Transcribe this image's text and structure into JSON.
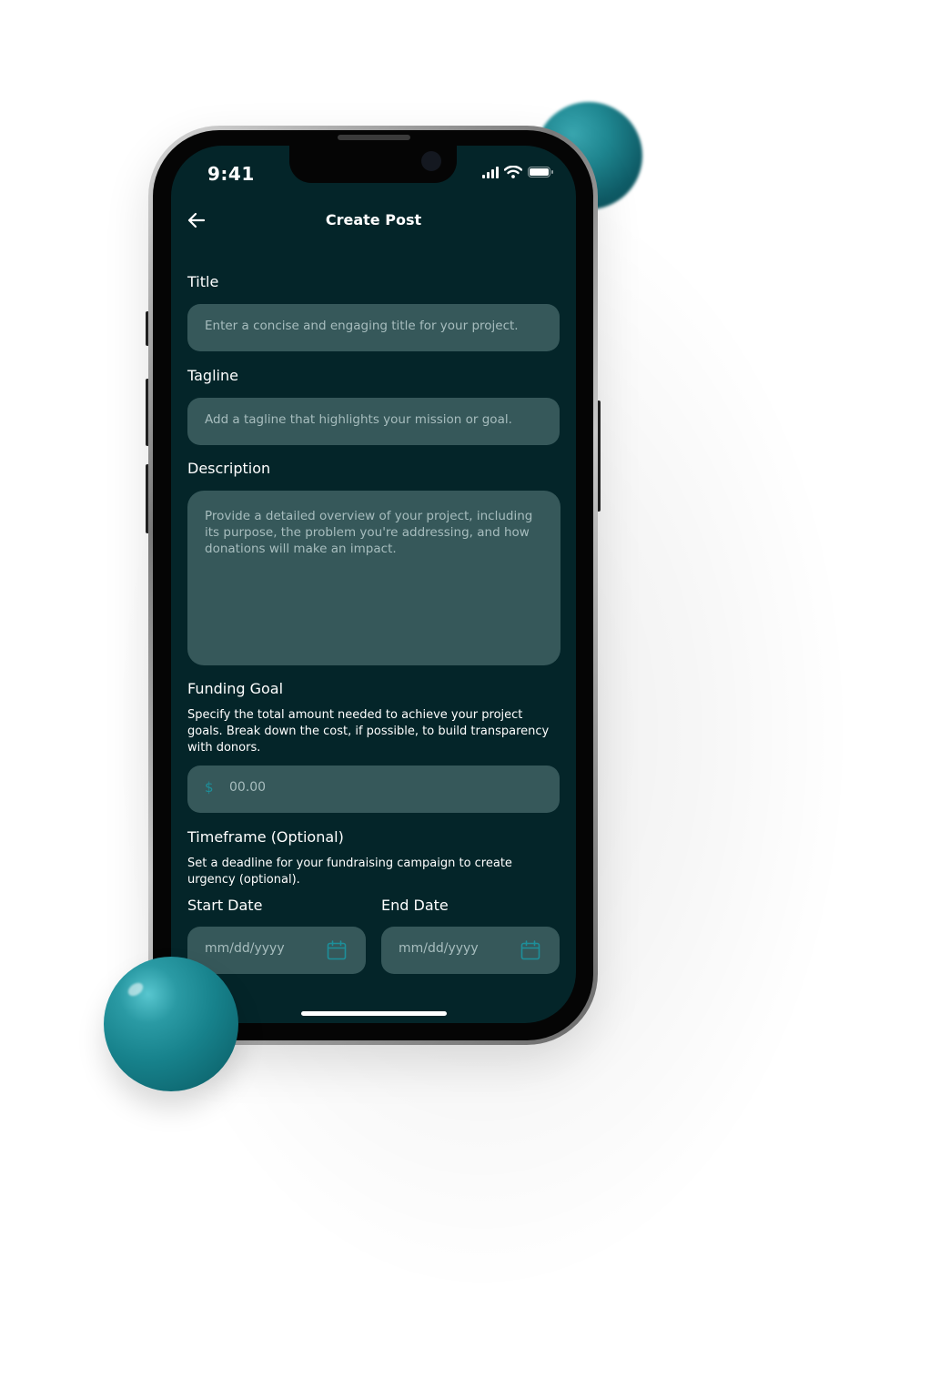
{
  "status_bar": {
    "time": "9:41"
  },
  "header": {
    "title": "Create Post",
    "back_icon": "arrow-left-icon"
  },
  "form": {
    "title": {
      "label": "Title",
      "placeholder": "Enter a concise and engaging title for your project."
    },
    "tagline": {
      "label": "Tagline",
      "placeholder": "Add a tagline that highlights your mission or goal."
    },
    "description": {
      "label": "Description",
      "placeholder": "Provide a detailed overview of your project, including its purpose, the problem you're addressing, and how donations will make an impact."
    },
    "funding_goal": {
      "label": "Funding Goal",
      "helper": "Specify the total amount needed to achieve your project goals. Break down the cost, if possible, to build transparency with donors.",
      "currency_symbol": "$",
      "placeholder": "00.00"
    },
    "timeframe": {
      "label": "Timeframe (Optional)",
      "helper": "Set a deadline for your fundraising campaign to create urgency (optional).",
      "start_label": "Start Date",
      "end_label": "End Date",
      "start_placeholder": "mm/dd/yyyy",
      "end_placeholder": "mm/dd/yyyy",
      "calendar_icon": "calendar-icon"
    }
  },
  "colors": {
    "screen_bg": "#042529",
    "field_bg": "#36585a",
    "accent": "#1d8f9a",
    "sphere": "#1f8791"
  }
}
